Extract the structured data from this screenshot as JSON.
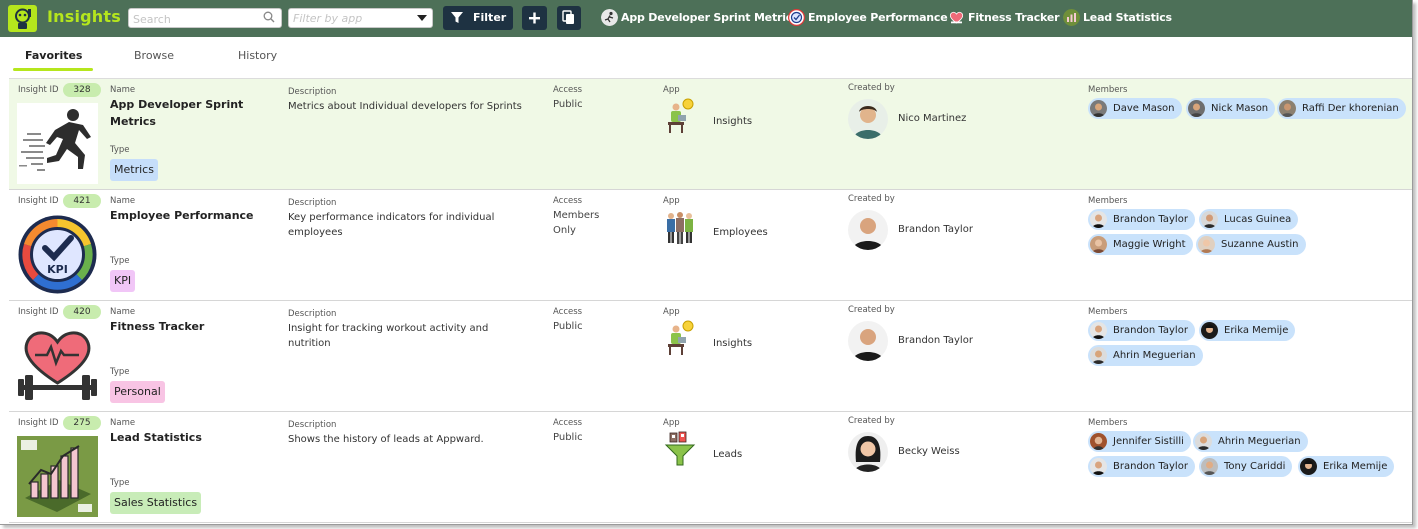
{
  "app": {
    "title": "Insights"
  },
  "toolbar": {
    "search_placeholder": "Search",
    "filter_placeholder": "Filter by app",
    "filter_label": "Filter"
  },
  "favorites_bar": [
    {
      "label": "App Developer Sprint Metrics",
      "icon": "runner-icon"
    },
    {
      "label": "Employee Performance",
      "icon": "kpi-icon"
    },
    {
      "label": "Fitness Tracker",
      "icon": "heart-icon"
    },
    {
      "label": "Lead Statistics",
      "icon": "chart-icon"
    }
  ],
  "tabs": [
    {
      "label": "Favorites",
      "active": true
    },
    {
      "label": "Browse",
      "active": false
    },
    {
      "label": "History",
      "active": false
    }
  ],
  "labels": {
    "insight_id": "Insight ID",
    "name": "Name",
    "type": "Type",
    "description": "Description",
    "access": "Access",
    "app": "App",
    "created_by": "Created by",
    "members": "Members"
  },
  "insights": [
    {
      "id": "328",
      "name": "App Developer Sprint Metrics",
      "type": "Metrics",
      "description": "Metrics about Individual developers for Sprints",
      "access": "Public",
      "app": "Insights",
      "created_by": "Nico Martinez",
      "members": [
        "Dave Mason",
        "Nick Mason",
        "Raffi Der khorenian"
      ]
    },
    {
      "id": "421",
      "name": "Employee Performance",
      "type": "KPI",
      "description": "Key performance indicators for individual employees",
      "access": "Members Only",
      "app": "Employees",
      "created_by": "Brandon Taylor",
      "members": [
        "Brandon Taylor",
        "Lucas Guinea",
        "Maggie Wright",
        "Suzanne Austin"
      ]
    },
    {
      "id": "420",
      "name": "Fitness Tracker",
      "type": "Personal",
      "description": "Insight for tracking workout activity and nutrition",
      "access": "Public",
      "app": "Insights",
      "created_by": "Brandon Taylor",
      "members": [
        "Brandon Taylor",
        "Erika Memije",
        "Ahrin Meguerian"
      ]
    },
    {
      "id": "275",
      "name": "Lead Statistics",
      "type": "Sales Statistics",
      "description": "Shows the history of leads at Appward.",
      "access": "Public",
      "app": "Leads",
      "created_by": "Becky Weiss",
      "members": [
        "Jennifer Sistilli",
        "Ahrin Meguerian",
        "Brandon Taylor",
        "Tony Cariddi",
        "Erika Memije"
      ]
    }
  ],
  "colors": {
    "topbar": "#4d7058",
    "accent": "#b5e61d",
    "highlight_row": "#f0f9e6",
    "id_badge": "#c8ecae",
    "member_chip": "#c9e2fb",
    "type_metrics": "#c6defa",
    "type_kpi": "#f1c6f7",
    "type_personal": "#f8c4e4",
    "type_sales": "#c8ecb8"
  }
}
